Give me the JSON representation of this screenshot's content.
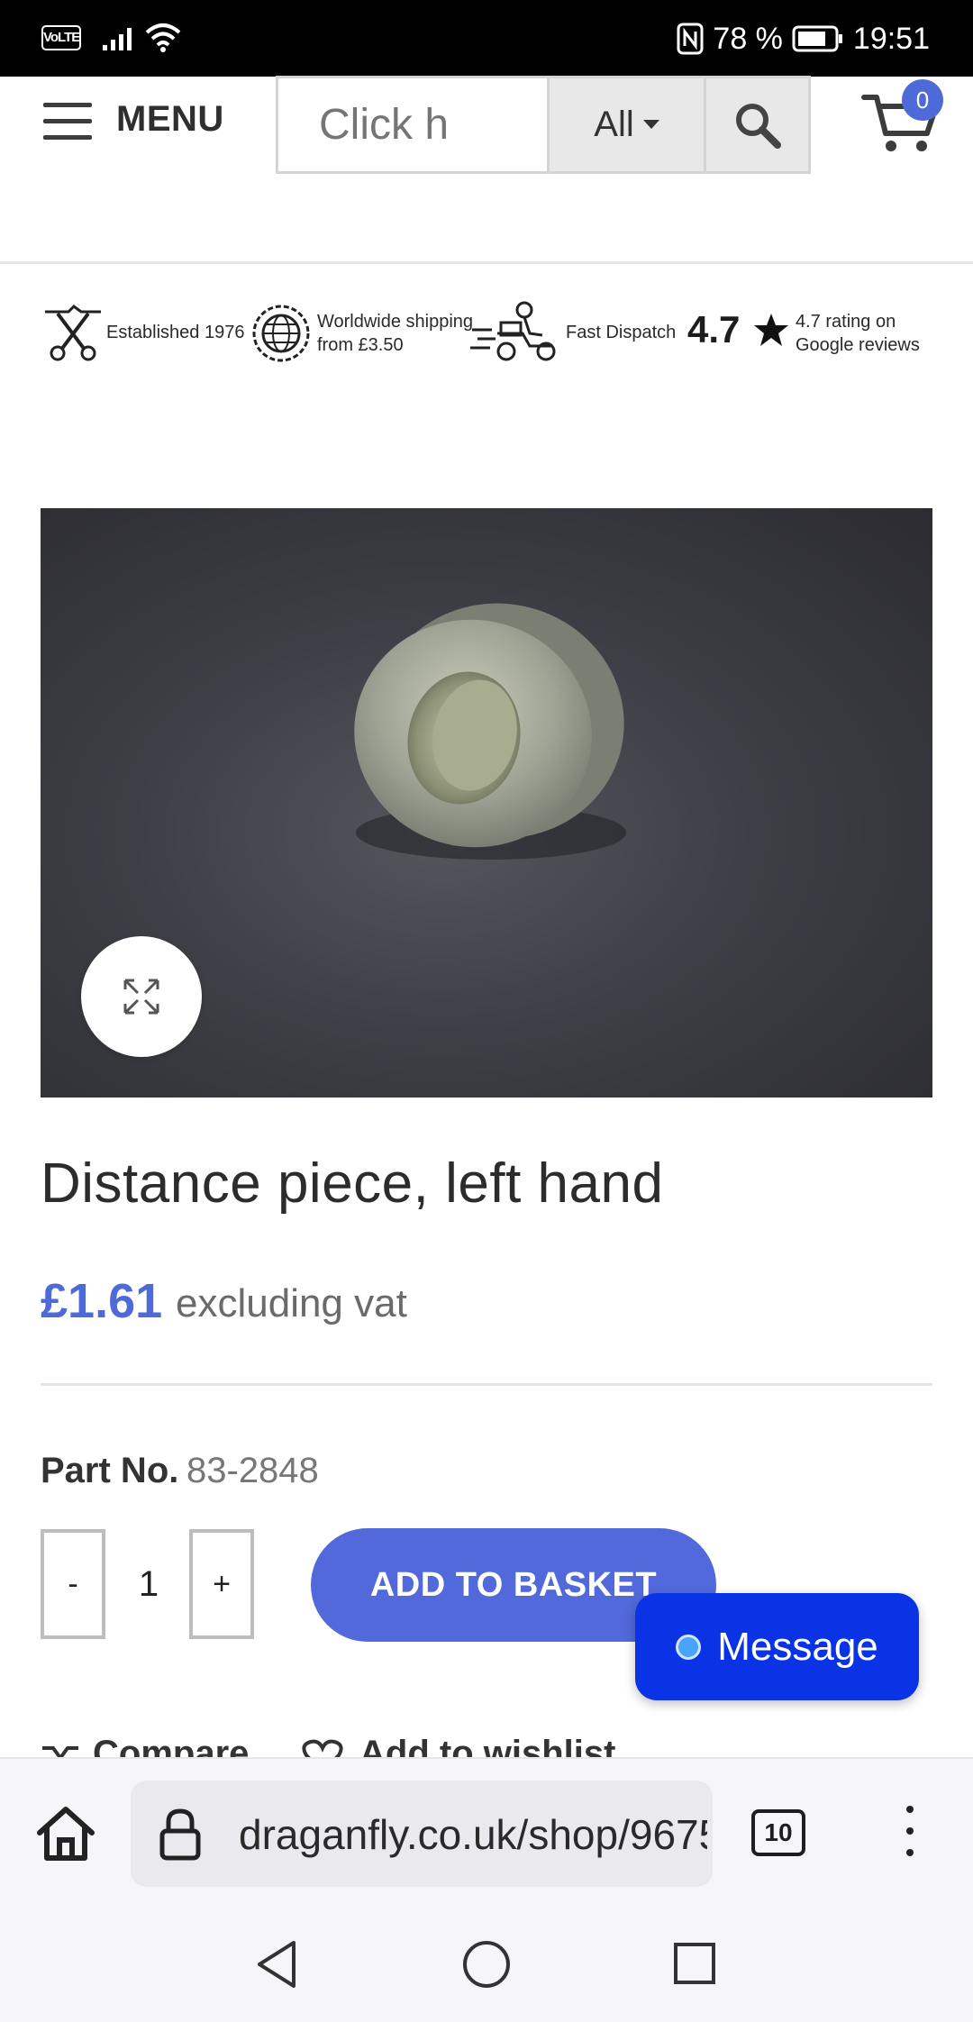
{
  "status_bar": {
    "volte": "VoLTE",
    "battery": "78 %",
    "time": "19:51"
  },
  "header": {
    "menu_label": "MENU",
    "search_placeholder": "Click h",
    "search_category": "All",
    "cart_count": "0"
  },
  "features": {
    "established": "Established 1976",
    "shipping_line1": "Worldwide shipping",
    "shipping_line2": "from £3.50",
    "dispatch": "Fast Dispatch",
    "rating": "4.7",
    "rating_line1": "4.7 rating on",
    "rating_line2": "Google reviews"
  },
  "product": {
    "title": "Distance piece, left hand",
    "price": "£1.61",
    "price_note": "excluding vat",
    "part_no_label": "Part No.",
    "part_no_value": "83-2848",
    "quantity": "1",
    "qty_minus": "-",
    "qty_plus": "+",
    "add_to_basket": "ADD TO BASKET",
    "compare": "Compare",
    "wishlist": "Add to wishlist"
  },
  "chat": {
    "message_label": "Message"
  },
  "browser": {
    "url": "draganfly.co.uk/shop/9675",
    "tab_count": "10"
  },
  "colors": {
    "accent": "#4e6ad9",
    "message_button": "#0b33e6"
  }
}
